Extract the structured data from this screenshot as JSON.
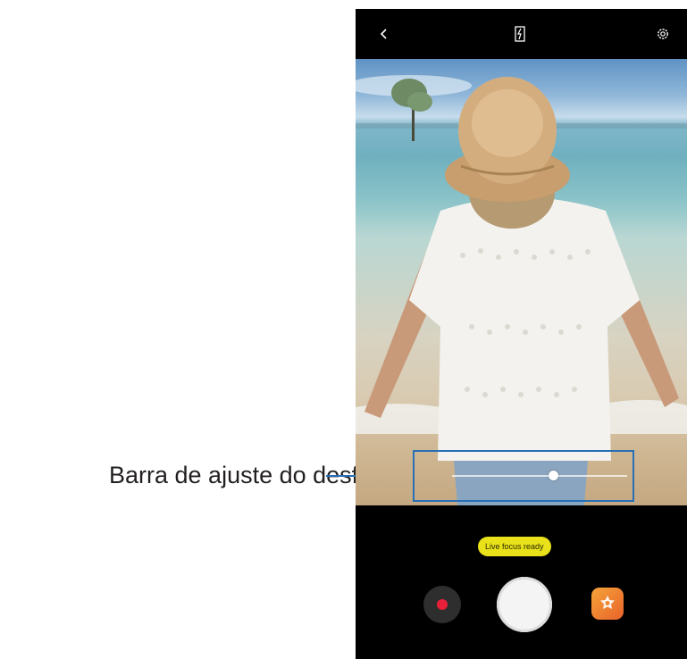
{
  "callout": {
    "label": "Barra de ajuste do desfoque"
  },
  "camera": {
    "top_bar": {
      "back_icon": "chevron-left-icon",
      "flash_icon": "flash-off-icon",
      "settings_icon": "gear-icon"
    },
    "status_text": "Live focus ready",
    "blur_level": 0.58,
    "bottom_bar": {
      "record_icon": "record-icon",
      "shutter_icon": "shutter-icon",
      "effects_icon": "sticker-effects-icon"
    }
  },
  "colors": {
    "callout_line": "#2a6fb5",
    "status_pill": "#e9e21a",
    "record_dot": "#e8203a",
    "effects_button": "#f08a30"
  }
}
